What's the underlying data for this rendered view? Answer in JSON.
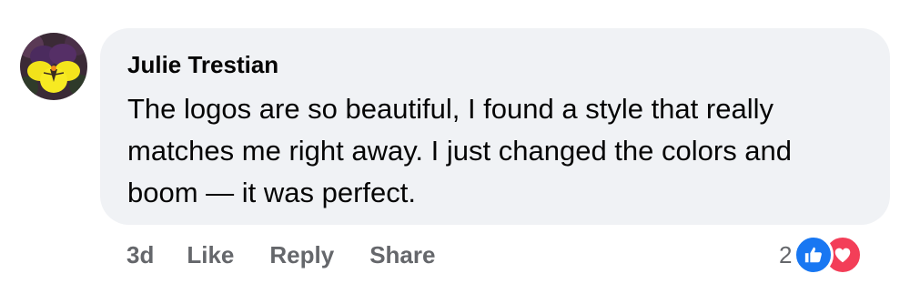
{
  "comment": {
    "author": "Julie Trestian",
    "text": "The logos are so beautiful, I found a style that really matches me right away. I just changed the colors and boom — it was perfect.",
    "avatar_icon": "pansy-flower-avatar"
  },
  "actions": {
    "timestamp": "3d",
    "like_label": "Like",
    "reply_label": "Reply",
    "share_label": "Share"
  },
  "reactions": {
    "count": "2",
    "types": [
      "like-icon",
      "love-icon"
    ],
    "colors": {
      "like": "#1877f2",
      "love": "#f33e58"
    }
  },
  "colors": {
    "bubble": "#f0f2f5",
    "text": "#050505",
    "secondary_text": "#65676b"
  }
}
